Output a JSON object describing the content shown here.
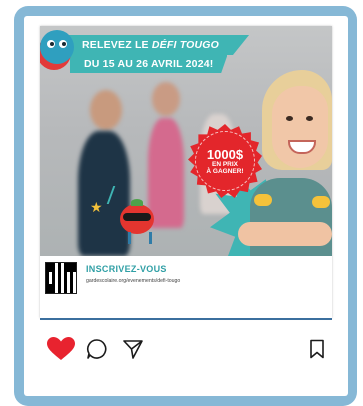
{
  "post": {
    "banner_line1_prefix": "RELEVEZ LE ",
    "banner_line1_emph": "DÉFI TOUGO",
    "banner_line2": "DU 15 AU 26 AVRIL 2024!",
    "badge": {
      "amount": "1000$",
      "line1": "EN PRIX",
      "line2": "À GAGNER!"
    },
    "cta": "INSCRIVEZ-VOUS",
    "url": "gardescolaire.org/evenements/defi-tougo"
  },
  "colors": {
    "frame": "#86b8d6",
    "banner": "#3fb5b4",
    "badge": "#e3262b",
    "like": "#e8232f"
  },
  "actions": {
    "like_icon": "heart-icon",
    "comment_icon": "comment-icon",
    "share_icon": "share-icon",
    "save_icon": "bookmark-icon",
    "liked": true
  }
}
